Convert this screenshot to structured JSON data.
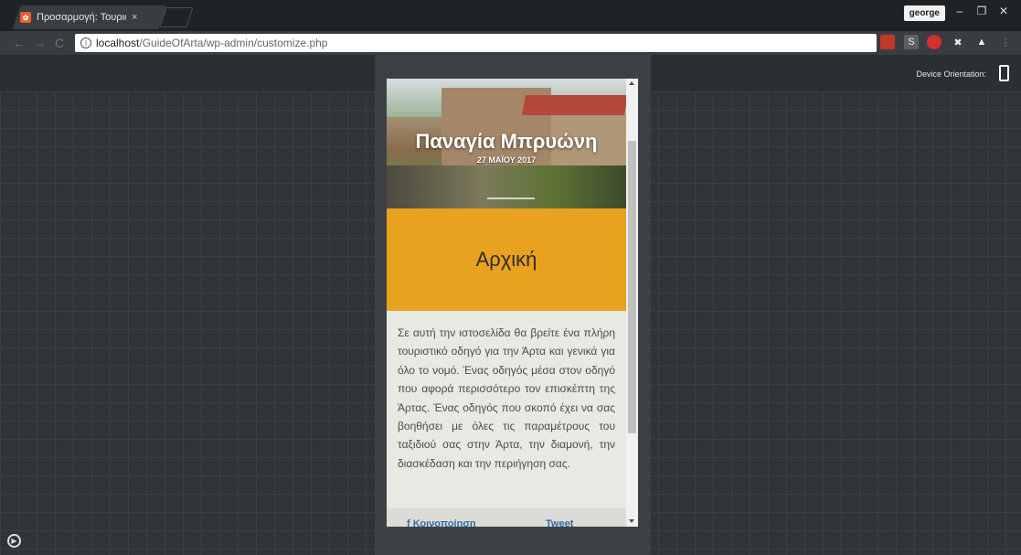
{
  "browser": {
    "tab_title": "Προσαρμογή: Τουριστικ",
    "tab_close": "×",
    "user": "george",
    "min": "–",
    "restore": "❐",
    "close": "✕",
    "back": "←",
    "forward": "→",
    "reload": "C",
    "url_host": "localhost",
    "url_path": "/GuideOfArta/wp-admin/customize.php",
    "star": "☆"
  },
  "customizer": {
    "device_orientation_label": "Device Orientation:"
  },
  "preview": {
    "hero_title": "Παναγία Μπρυώνη",
    "hero_date": "27 ΜΑΪΟΥ 2017",
    "banner_title": "Αρχική",
    "body_text": "Σε αυτή την ιστοσελίδα θα βρείτε ένα πλήρη τουριστικό οδηγό για την Άρτα και γενικά για όλο το νομό. Ένας οδηγός μέσα στον οδηγό που αφορά περισσότερο τον επισκέπτη της Άρτας. Ένας οδηγός που σκοπό έχει να σας βοηθήσει με όλες τις παραμέτρους του ταξιδιού σας στην Άρτα, την διαμονή, την διασκέδαση και την περιήγηση σας.",
    "share_facebook": "f Κοινοποίηση",
    "share_twitter": "Tweet"
  }
}
